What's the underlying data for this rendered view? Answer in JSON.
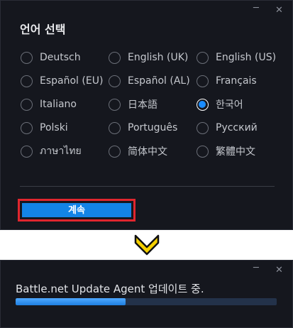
{
  "language_dialog": {
    "title": "언어 선택",
    "minimize_glyph": "─",
    "close_glyph": "✕",
    "languages": [
      {
        "label": "Deutsch",
        "selected": false
      },
      {
        "label": "English (UK)",
        "selected": false
      },
      {
        "label": "English (US)",
        "selected": false
      },
      {
        "label": "Español (EU)",
        "selected": false
      },
      {
        "label": "Español (AL)",
        "selected": false
      },
      {
        "label": "Français",
        "selected": false
      },
      {
        "label": "Italiano",
        "selected": false
      },
      {
        "label": "日本語",
        "selected": false
      },
      {
        "label": "한국어",
        "selected": true
      },
      {
        "label": "Polski",
        "selected": false
      },
      {
        "label": "Português",
        "selected": false
      },
      {
        "label": "Русский",
        "selected": false
      },
      {
        "label": "ภาษาไทย",
        "selected": false
      },
      {
        "label": "简体中文",
        "selected": false
      },
      {
        "label": "繁體中文",
        "selected": false
      }
    ],
    "continue_label": "계속"
  },
  "update_window": {
    "minimize_glyph": "─",
    "close_glyph": "✕",
    "status_text": "Battle.net Update Agent 업데이트 중.",
    "progress": 0.42
  },
  "colors": {
    "window_bg": "#15171e",
    "accent": "#1384e6",
    "highlight": "#e0262e",
    "arrow": "#f5d000"
  }
}
